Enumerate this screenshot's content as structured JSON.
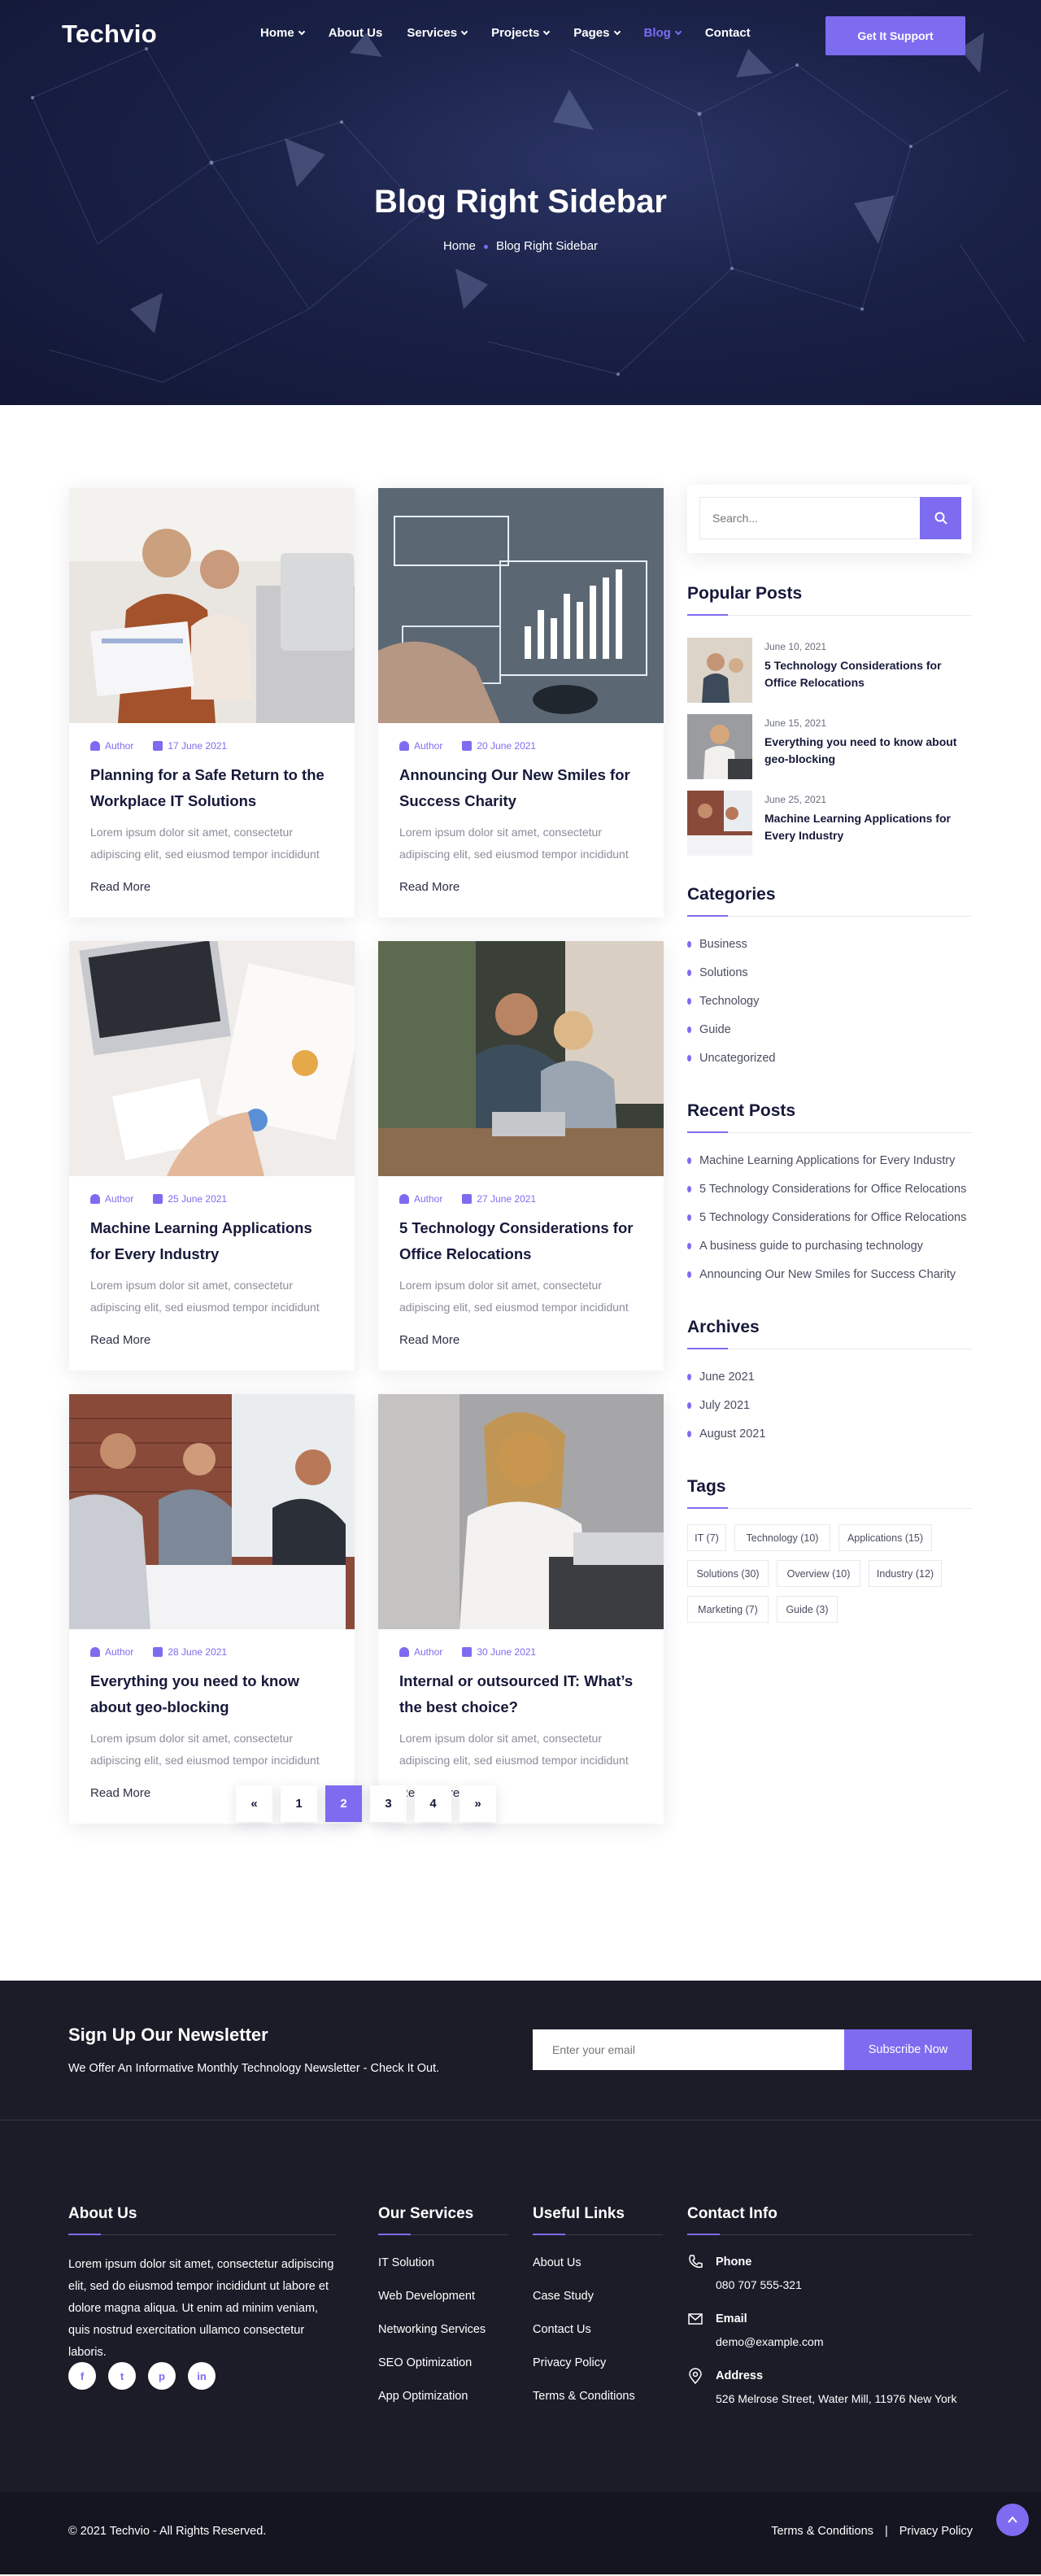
{
  "brand": {
    "logo": "Techvio"
  },
  "nav": {
    "items": [
      {
        "label": "Home",
        "dropdown": true
      },
      {
        "label": "About Us",
        "dropdown": false
      },
      {
        "label": "Services",
        "dropdown": true
      },
      {
        "label": "Projects",
        "dropdown": true
      },
      {
        "label": "Pages",
        "dropdown": true
      },
      {
        "label": "Blog",
        "dropdown": true,
        "active": true
      },
      {
        "label": "Contact",
        "dropdown": false
      }
    ],
    "cta": "Get It Support"
  },
  "hero": {
    "title": "Blog Right Sidebar",
    "breadcrumb": [
      "Home",
      "Blog Right Sidebar"
    ]
  },
  "posts": [
    {
      "author": "Author",
      "date": "17 June 2021",
      "title": "Planning for a Safe Return to the Workplace IT Solutions",
      "excerpt": "Lorem ipsum dolor sit amet, consectetur adipiscing elit, sed eiusmod tempor incididunt",
      "read_more": "Read More"
    },
    {
      "author": "Author",
      "date": "20 June 2021",
      "title": "Announcing Our New Smiles for Success Charity",
      "excerpt": "Lorem ipsum dolor sit amet, consectetur adipiscing elit, sed eiusmod tempor incididunt",
      "read_more": "Read More"
    },
    {
      "author": "Author",
      "date": "25 June 2021",
      "title": "Machine Learning Applications for Every Industry",
      "excerpt": "Lorem ipsum dolor sit amet, consectetur adipiscing elit, sed eiusmod tempor incididunt",
      "read_more": "Read More"
    },
    {
      "author": "Author",
      "date": "27 June 2021",
      "title": "5 Technology Considerations for Office Relocations",
      "excerpt": "Lorem ipsum dolor sit amet, consectetur adipiscing elit, sed eiusmod tempor incididunt",
      "read_more": "Read More"
    },
    {
      "author": "Author",
      "date": "28 June 2021",
      "title": "Everything you need to know about geo-blocking",
      "excerpt": "Lorem ipsum dolor sit amet, consectetur adipiscing elit, sed eiusmod tempor incididunt",
      "read_more": "Read More"
    },
    {
      "author": "Author",
      "date": "30 June 2021",
      "title": "Internal or outsourced IT: What’s the best choice?",
      "excerpt": "Lorem ipsum dolor sit amet, consectetur adipiscing elit, sed eiusmod tempor incididunt",
      "read_more": "Read More"
    }
  ],
  "pagination": {
    "prev": "«",
    "pages": [
      "1",
      "2",
      "3",
      "4"
    ],
    "current": "2",
    "next": "»"
  },
  "sidebar": {
    "search_placeholder": "Search...",
    "popular_title": "Popular Posts",
    "popular": [
      {
        "date": "June 10, 2021",
        "title": "5 Technology Considerations for Office Relocations"
      },
      {
        "date": "June 15, 2021",
        "title": "Everything you need to know about geo-blocking"
      },
      {
        "date": "June 25, 2021",
        "title": "Machine Learning Applications for Every Industry"
      }
    ],
    "categories_title": "Categories",
    "categories": [
      "Business",
      "Solutions",
      "Technology",
      "Guide",
      "Uncategorized"
    ],
    "recent_title": "Recent Posts",
    "recent": [
      "Machine Learning Applications for Every Industry",
      "5 Technology Considerations for Office Relocations",
      "5 Technology Considerations for Office Relocations",
      "A business guide to purchasing technology",
      "Announcing Our New Smiles for Success Charity"
    ],
    "archives_title": "Archives",
    "archives": [
      "June 2021",
      "July 2021",
      "August 2021"
    ],
    "tags_title": "Tags",
    "tags": [
      "IT (7)",
      "Technology (10)",
      "Applications (15)",
      "Solutions (30)",
      "Overview (10)",
      "Industry (12)",
      "Marketing (7)",
      "Guide (3)"
    ]
  },
  "newsletter": {
    "title": "Sign Up Our Newsletter",
    "subtitle": "We Offer An Informative Monthly Technology Newsletter - Check It Out.",
    "placeholder": "Enter your email",
    "button": "Subscribe Now"
  },
  "footer": {
    "about_title": "About Us",
    "about_text": "Lorem ipsum dolor sit amet, consectetur adipiscing elit, sed do eiusmod tempor incididunt ut labore et dolore magna aliqua. Ut enim ad minim veniam, quis nostrud exercitation ullamco consectetur laboris.",
    "social": [
      "facebook-icon",
      "twitter-icon",
      "pinterest-icon",
      "linkedin-icon"
    ],
    "services_title": "Our Services",
    "services": [
      "IT Solution",
      "Web Development",
      "Networking Services",
      "SEO Optimization",
      "App Optimization"
    ],
    "links_title": "Useful Links",
    "links": [
      "About Us",
      "Case Study",
      "Contact Us",
      "Privacy Policy",
      "Terms & Conditions"
    ],
    "contact_title": "Contact Info",
    "contact": [
      {
        "icon": "phone-icon",
        "label": "Phone",
        "value": "080 707 555-321"
      },
      {
        "icon": "email-icon",
        "label": "Email",
        "value": "demo@example.com"
      },
      {
        "icon": "location-icon",
        "label": "Address",
        "value": "526 Melrose Street, Water Mill, 11976 New York"
      }
    ],
    "copyright": "© 2021 Techvio - All Rights Reserved.",
    "bottom_links": [
      "Terms & Conditions",
      "Privacy Policy"
    ],
    "separator": "|"
  },
  "colors": {
    "accent": "#7d6cf0",
    "dark": "#1b1c28",
    "heading": "#16193a"
  }
}
